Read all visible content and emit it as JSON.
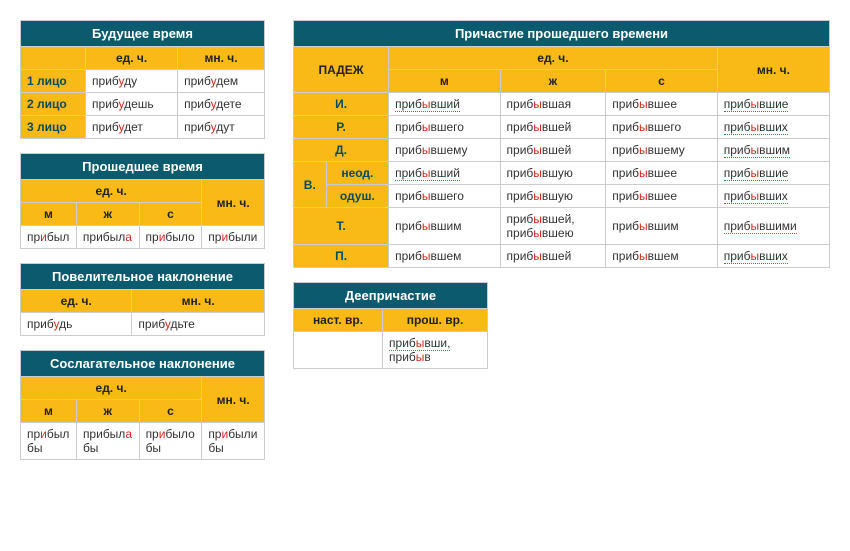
{
  "future": {
    "title": "Будущее время",
    "h_sg": "ед. ч.",
    "h_pl": "мн. ч.",
    "r1": {
      "label": "1 лицо",
      "sg_pre": "приб",
      "sg_s": "у",
      "sg_post": "ду",
      "pl_pre": "приб",
      "pl_s": "у",
      "pl_post": "дем"
    },
    "r2": {
      "label": "2 лицо",
      "sg_pre": "приб",
      "sg_s": "у",
      "sg_post": "дешь",
      "pl_pre": "приб",
      "pl_s": "у",
      "pl_post": "дете"
    },
    "r3": {
      "label": "3 лицо",
      "sg_pre": "приб",
      "sg_s": "у",
      "sg_post": "дет",
      "pl_pre": "приб",
      "pl_s": "у",
      "pl_post": "дут"
    }
  },
  "past": {
    "title": "Прошедшее время",
    "h_sg": "ед. ч.",
    "h_pl": "мн. ч.",
    "h_m": "м",
    "h_f": "ж",
    "h_n": "с",
    "m": {
      "pre": "пр",
      "s": "и",
      "post": "был"
    },
    "f": {
      "pre": "прибыл",
      "s": "а",
      "post": ""
    },
    "n": {
      "pre": "пр",
      "s": "и",
      "post": "было"
    },
    "pl": {
      "pre": "пр",
      "s": "и",
      "post": "были"
    }
  },
  "imp": {
    "title": "Повелительное наклонение",
    "h_sg": "ед. ч.",
    "h_pl": "мн. ч.",
    "sg": {
      "pre": "приб",
      "s": "у",
      "post": "дь"
    },
    "pl": {
      "pre": "приб",
      "s": "у",
      "post": "дьте"
    }
  },
  "subj": {
    "title": "Сослагательное наклонение",
    "h_sg": "ед. ч.",
    "h_pl": "мн. ч.",
    "h_m": "м",
    "h_f": "ж",
    "h_n": "с",
    "m": {
      "pre": "пр",
      "s": "и",
      "post": "был бы"
    },
    "f": {
      "pre": "прибыл",
      "s": "а",
      "post": " бы"
    },
    "n": {
      "pre": "пр",
      "s": "и",
      "post": "было бы"
    },
    "pl": {
      "pre": "пр",
      "s": "и",
      "post": "были бы"
    }
  },
  "part": {
    "title": "Причастие прошедшего времени",
    "h_case": "ПАДЕЖ",
    "h_sg": "ед. ч.",
    "h_pl": "мн. ч.",
    "h_m": "м",
    "h_f": "ж",
    "h_n": "с",
    "case_i": "И.",
    "case_r": "Р.",
    "case_d": "Д.",
    "case_v": "В.",
    "case_v_in": "неод.",
    "case_v_an": "одуш.",
    "case_t": "Т.",
    "case_p": "П.",
    "i": {
      "m": "вший",
      "f": "вшая",
      "n": "вшее",
      "pl": "вшие"
    },
    "r": {
      "m": "вшего",
      "f": "вшей",
      "n": "вшего",
      "pl": "вших"
    },
    "d": {
      "m": "вшему",
      "f": "вшей",
      "n": "вшему",
      "pl": "вшим"
    },
    "v_in": {
      "m": "вший",
      "f": "вшую",
      "n": "вшее",
      "pl": "вшие"
    },
    "v_an": {
      "m": "вшего",
      "f": "вшую",
      "n": "вшее",
      "pl": "вших"
    },
    "t": {
      "m": "вшим",
      "f1": "вшей,",
      "f2": "вшею",
      "n": "вшим",
      "pl": "вшими"
    },
    "p": {
      "m": "вшем",
      "f": "вшей",
      "n": "вшем",
      "pl": "вших"
    },
    "pre": "приб",
    "stress": "ы"
  },
  "de": {
    "title": "Деепричастие",
    "h_pres": "наст. вр.",
    "h_past": "прош. вр.",
    "past1_pre": "приб",
    "past1_s": "ы",
    "past1_post": "вши,",
    "past2_pre": "приб",
    "past2_s": "ы",
    "past2_post": "в"
  }
}
